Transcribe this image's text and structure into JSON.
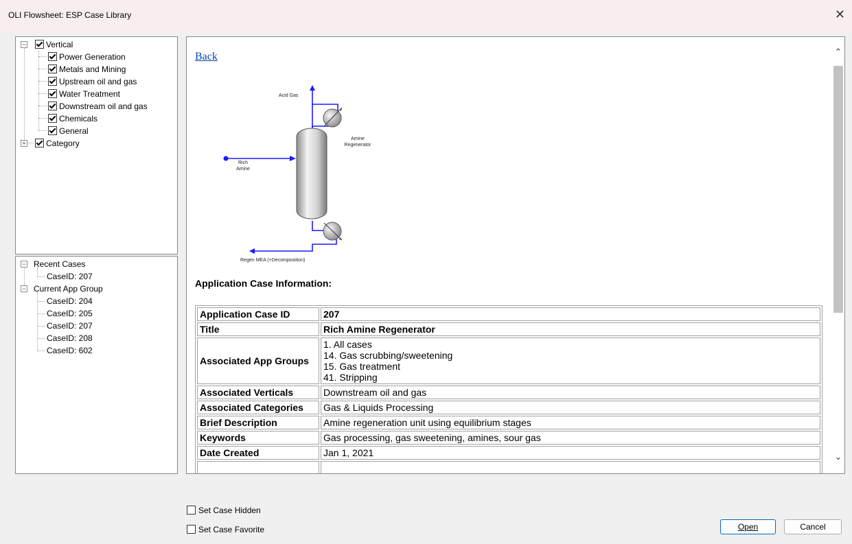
{
  "window": {
    "title": "OLI Flowsheet: ESP Case Library",
    "close_glyph": "✕"
  },
  "tree_top": {
    "vertical": {
      "label": "Vertical",
      "checked": true,
      "expanded": true
    },
    "vertical_items": [
      {
        "label": "Power Generation",
        "checked": true
      },
      {
        "label": "Metals and Mining",
        "checked": true
      },
      {
        "label": "Upstream oil and gas",
        "checked": true
      },
      {
        "label": "Water Treatment",
        "checked": true
      },
      {
        "label": "Downstream oil and gas",
        "checked": true
      },
      {
        "label": "Chemicals",
        "checked": true
      },
      {
        "label": "General",
        "checked": true
      }
    ],
    "category": {
      "label": "Category",
      "checked": true,
      "expanded": false
    }
  },
  "tree_bottom": {
    "recent": {
      "label": "Recent Cases",
      "items": [
        "CaseID: 207"
      ]
    },
    "group": {
      "label": "Current App Group",
      "items": [
        "CaseID: 204",
        "CaseID: 205",
        "CaseID: 207",
        "CaseID: 208",
        "CaseID: 602"
      ]
    }
  },
  "content": {
    "back_link": "Back",
    "diagram": {
      "acid_gas": "Acid Gas",
      "amine": "Amine",
      "regenerator": "Regenerator",
      "rich": "Rich",
      "rich_amine": "Amine",
      "regen_mea": "Regen MEA (+Decomposition)",
      "stream_color": "#1a1aff"
    },
    "section_title": "Application Case Information:",
    "rows": {
      "case_id": {
        "key": "Application Case ID",
        "value": "207"
      },
      "title": {
        "key": "Title",
        "value": "Rich Amine Regenerator"
      },
      "groups": {
        "key": "Associated App Groups",
        "lines": [
          "1. All cases",
          "14. Gas scrubbing/sweetening",
          "15. Gas treatment",
          "41. Stripping"
        ]
      },
      "verticals": {
        "key": "Associated Verticals",
        "value": "Downstream oil and gas"
      },
      "categories": {
        "key": "Associated Categories",
        "value": "Gas & Liquids Processing"
      },
      "description": {
        "key": "Brief Description",
        "value": "Amine regeneration unit using equilibrium stages"
      },
      "keywords": {
        "key": "Keywords",
        "value": "Gas processing, gas sweetening, amines, sour gas"
      },
      "date": {
        "key": "Date Created",
        "value": "Jan 1, 2021"
      }
    }
  },
  "footer": {
    "hidden_label": "Set Case Hidden",
    "favorite_label": "Set Case Favorite",
    "open_label": "Open",
    "cancel_label": "Cancel"
  },
  "colors": {
    "link": "#0645ad",
    "primary_border": "#0067c0"
  }
}
